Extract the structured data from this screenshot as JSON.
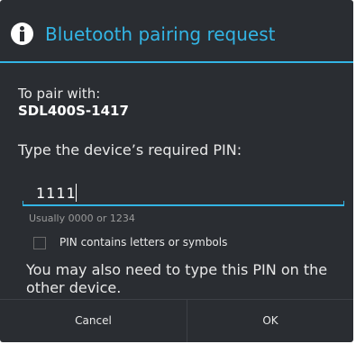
{
  "dialog": {
    "title": "Bluetooth pairing request",
    "title_icon": "info-icon",
    "accent_color": "#33b5e5",
    "pair_with_label": "To pair with:",
    "device_name": "SDL400S-1417",
    "pin_prompt": "Type the device’s required PIN:",
    "pin_value": "1111",
    "pin_hint": "Usually 0000 or 1234",
    "checkbox_label": "PIN contains letters or symbols",
    "checkbox_checked": false,
    "note": "You may also need to type this PIN on the other device.",
    "buttons": {
      "cancel": "Cancel",
      "ok": "OK"
    }
  }
}
